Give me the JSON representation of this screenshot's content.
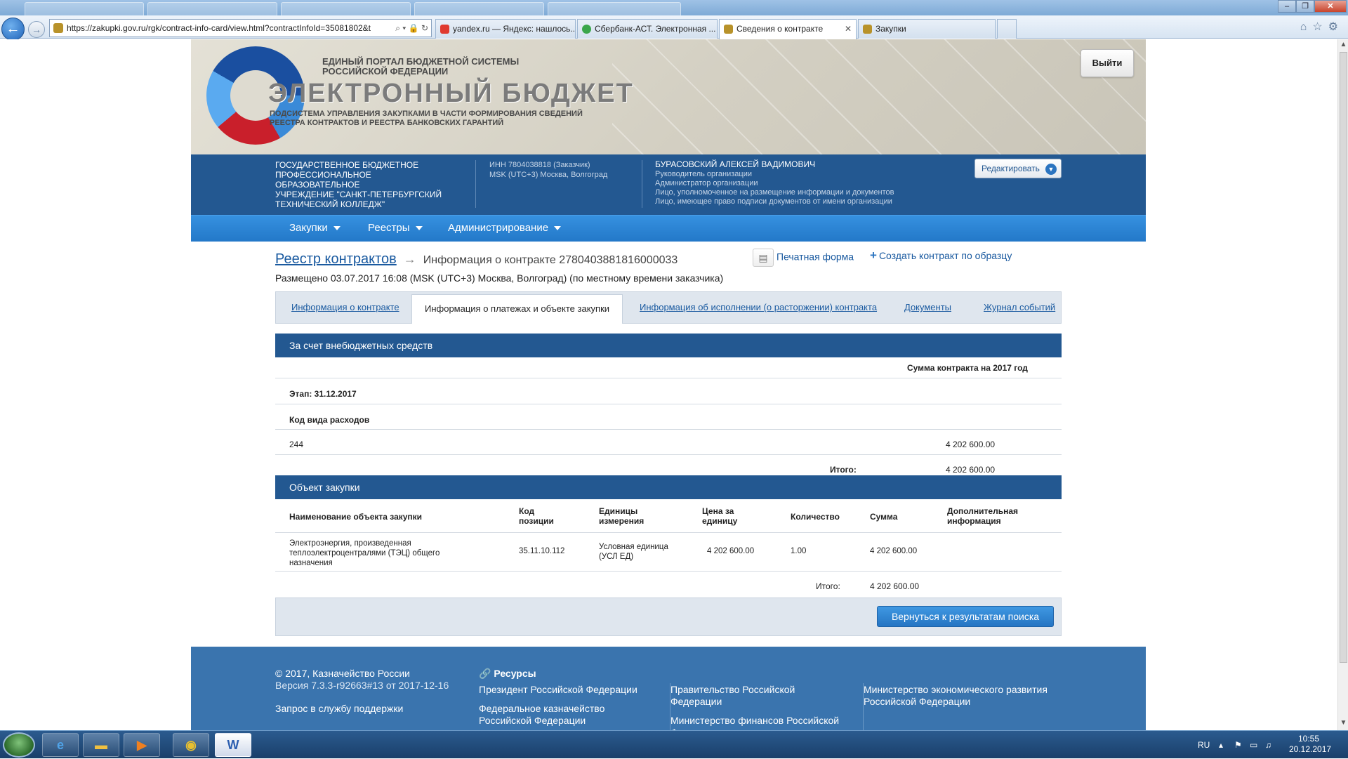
{
  "browser": {
    "url": "https://zakupki.gov.ru/rgk/contract-info-card/view.html?contractInfoId=35081802&t",
    "tabs": [
      {
        "label": "yandex.ru — Яндекс: нашлось...",
        "color": "#e03a2f"
      },
      {
        "label": "Сбербанк-АСТ. Электронная ...",
        "color": "#3aa64a"
      },
      {
        "label": "Сведения о контракте",
        "color": "#b8922a"
      },
      {
        "label": "Закупки",
        "color": "#b8922a"
      }
    ]
  },
  "header": {
    "portal_line1": "ЕДИНЫЙ ПОРТАЛ БЮДЖЕТНОЙ СИСТЕМЫ",
    "portal_line2": "РОССИЙСКОЙ ФЕДЕРАЦИИ",
    "title": "ЭЛЕКТРОННЫЙ БЮДЖЕТ",
    "subtitle_line1": "ПОДСИСТЕМА УПРАВЛЕНИЯ ЗАКУПКАМИ В ЧАСТИ ФОРМИРОВАНИЯ СВЕДЕНИЙ",
    "subtitle_line2": "РЕЕСТРА КОНТРАКТОВ И РЕЕСТРА БАНКОВСКИХ ГАРАНТИЙ",
    "logout": "Выйти"
  },
  "infobar": {
    "org_lines": [
      "ГОСУДАРСТВЕННОЕ БЮДЖЕТНОЕ",
      "ПРОФЕССИОНАЛЬНОЕ ОБРАЗОВАТЕЛЬНОЕ",
      "УЧРЕЖДЕНИЕ \"САНКТ-ПЕТЕРБУРГСКИЙ",
      "ТЕХНИЧЕСКИЙ КОЛЛЕДЖ\""
    ],
    "inn": "ИНН 7804038818 (Заказчик)",
    "tz": "MSK (UTC+3) Москва, Волгоград",
    "user_name": "БУРАСОВСКИЙ АЛЕКСЕЙ ВАДИМОВИЧ",
    "roles": [
      "Руководитель организации",
      "Администратор организации",
      "Лицо, уполномоченное на размещение информации и документов",
      "Лицо, имеющее право подписи документов от имени организации"
    ],
    "edit": "Редактировать"
  },
  "menu": [
    "Закупки",
    "Реестры",
    "Администрирование"
  ],
  "breadcrumb": {
    "registry": "Реестр контрактов",
    "current": "Информация о контракте 2780403881816000033"
  },
  "posted": "Размещено 03.07.2017 16:08 (MSK (UTC+3) Москва, Волгоград) (по местному времени заказчика)",
  "actions": {
    "print": "Печатная форма",
    "create": "Создать контракт по образцу"
  },
  "tabs": [
    "Информация о контракте",
    "Информация о платежах и объекте закупки",
    "Информация об исполнении (о расторжении) контракта",
    "Документы",
    "Журнал событий"
  ],
  "funding": {
    "title": "За счет внебюджетных средств",
    "sum_header": "Сумма контракта на 2017 год",
    "stage": "Этап: 31.12.2017",
    "code_header": "Код вида расходов",
    "code": "244",
    "code_amount": "4 202 600.00",
    "total_label": "Итого:",
    "total": "4 202 600.00"
  },
  "object": {
    "title": "Объект закупки",
    "headers": {
      "name": "Наименование объекта закупки",
      "code": "Код позиции",
      "unit": "Единицы измерения",
      "price": "Цена за единицу",
      "qty": "Количество",
      "sum": "Сумма",
      "extra": "Дополнительная информация"
    },
    "row": {
      "name": "Электроэнергия, произведенная теплоэлектроцентралями (ТЭЦ) общего назначения",
      "code": "35.11.10.112",
      "unit": "Условная единица (УСЛ ЕД)",
      "price": "4 202 600.00",
      "qty": "1.00",
      "sum": "4 202 600.00",
      "extra": ""
    },
    "total_label": "Итого:",
    "total": "4 202 600.00"
  },
  "back_button": "Вернуться к результатам поиска",
  "footer": {
    "copyright": "© 2017, Казначейство России",
    "version": "Версия 7.3.3-r92663#13 от 2017-12-16",
    "support": "Запрос в службу поддержки",
    "resources_title": "Ресурсы",
    "links": [
      "Президент Российской Федерации",
      "Федеральное казначейство Российской Федерации",
      "Правительство Российской Федерации",
      "Министерство финансов Российской Федерации",
      "Министерство экономического развития Российской Федерации"
    ]
  },
  "taskbar": {
    "lang": "RU",
    "time": "10:55",
    "date": "20.12.2017"
  }
}
